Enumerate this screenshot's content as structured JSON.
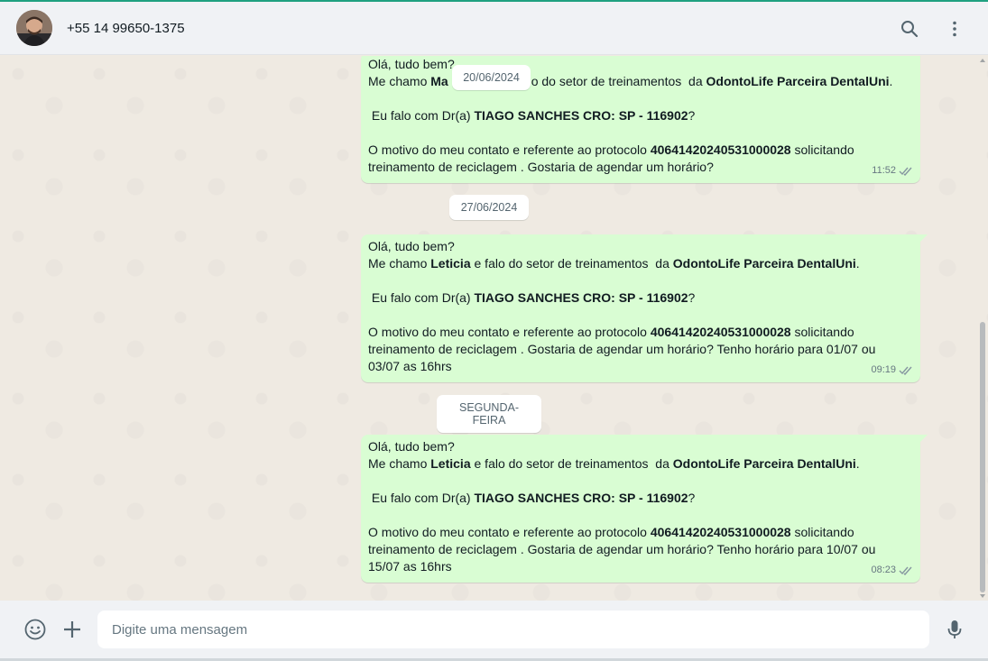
{
  "header": {
    "contact_name": "+55 14 99650-1375",
    "search_icon": "search-icon",
    "menu_icon": "kebab-menu-icon"
  },
  "dates": {
    "d1": "20/06/2024",
    "d2": "27/06/2024",
    "d3": "SEGUNDA-FEIRA"
  },
  "messages": [
    {
      "l1": "Olá, tudo bem?",
      "l2a": "Me chamo ",
      "l2b": "Ma",
      "l2c": "o do setor de treinamentos  da ",
      "l2d": "OdontoLife Parceira DentalUni",
      "l2e": ".",
      "l3a": " Eu falo com Dr(a) ",
      "l3b": "TIAGO SANCHES CRO: SP - 116902",
      "l3c": "?",
      "l4a": "O motivo do meu contato e referente ao protocolo ",
      "l4b": "40641420240531000028",
      "l4c": " solicitando",
      "l5": "treinamento de reciclagem . Gostaria de agendar um horário?",
      "time": "11:52"
    },
    {
      "l1": "Olá, tudo bem?",
      "l2a": "Me chamo ",
      "l2b": "Leticia",
      "l2c": " e falo do setor de treinamentos  da ",
      "l2d": "OdontoLife Parceira DentalUni",
      "l2e": ".",
      "l3a": " Eu falo com Dr(a) ",
      "l3b": "TIAGO SANCHES CRO: SP - 116902",
      "l3c": "?",
      "l4a": "O motivo do meu contato e referente ao protocolo ",
      "l4b": "40641420240531000028",
      "l4c": " solicitando",
      "l5": "treinamento de reciclagem . Gostaria de agendar um horário? Tenho horário para 01/07 ou",
      "l6": "03/07 as 16hrs",
      "time": "09:19"
    },
    {
      "l1": "Olá, tudo bem?",
      "l2a": "Me chamo ",
      "l2b": "Leticia",
      "l2c": " e falo do setor de treinamentos  da ",
      "l2d": "OdontoLife Parceira DentalUni",
      "l2e": ".",
      "l3a": " Eu falo com Dr(a) ",
      "l3b": "TIAGO SANCHES CRO: SP - 116902",
      "l3c": "?",
      "l4a": "O motivo do meu contato e referente ao protocolo ",
      "l4b": "40641420240531000028",
      "l4c": " solicitando",
      "l5": "treinamento de reciclagem . Gostaria de agendar um horário? Tenho horário para 10/07 ou",
      "l6": "15/07 as 16hrs",
      "time": "08:23"
    }
  ],
  "footer": {
    "placeholder": "Digite uma mensagem",
    "emoji_icon": "emoji-icon",
    "attach_icon": "plus-icon",
    "mic_icon": "microphone-icon"
  },
  "colors": {
    "accent": "#1fa180",
    "bubble_out": "#d9fdd3",
    "chat_bg": "#efeae2",
    "header_bg": "#f0f2f5"
  }
}
